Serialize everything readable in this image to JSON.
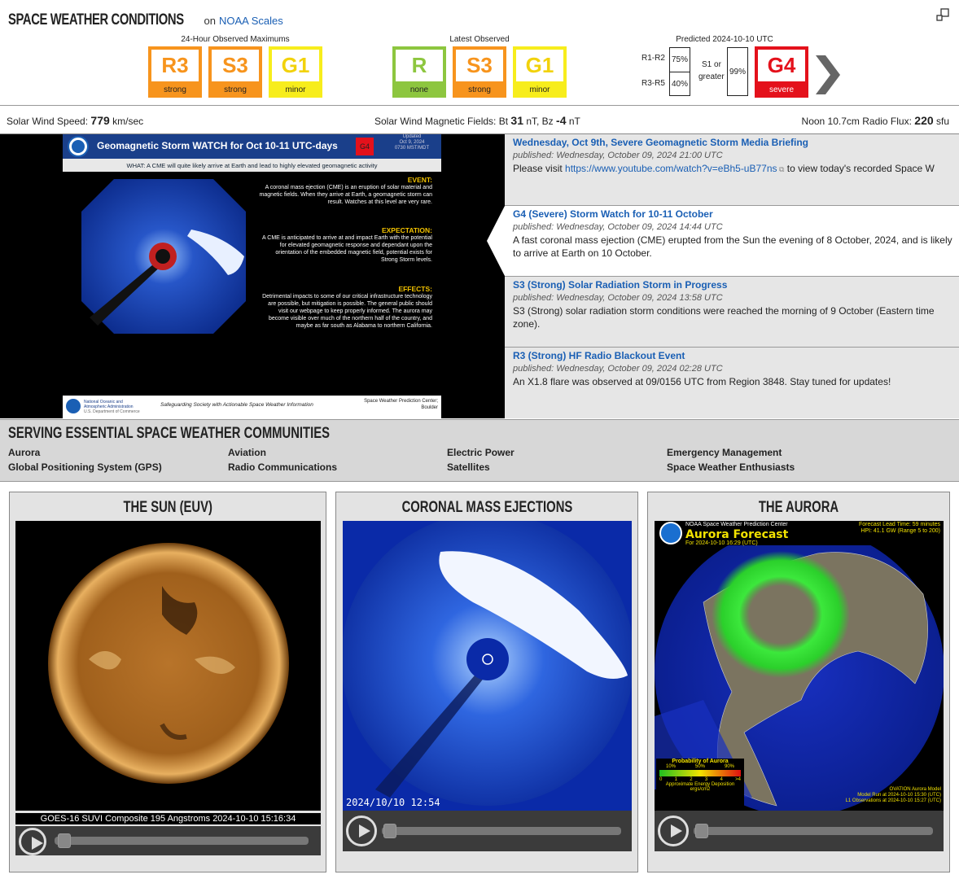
{
  "header": {
    "title": "SPACE WEATHER CONDITIONS",
    "on_text": "on",
    "scales_link": "NOAA Scales"
  },
  "observed": {
    "label": "24-Hour Observed Maximums",
    "scales": [
      {
        "code": "R3",
        "level": "strong",
        "color": "#f7941d"
      },
      {
        "code": "S3",
        "level": "strong",
        "color": "#f7941d"
      },
      {
        "code": "G1",
        "level": "minor",
        "color": "#f7ed1c"
      }
    ]
  },
  "latest": {
    "label": "Latest Observed",
    "scales": [
      {
        "code": "R",
        "level": "none",
        "color": "#8dc63f"
      },
      {
        "code": "S3",
        "level": "strong",
        "color": "#f7941d"
      },
      {
        "code": "G1",
        "level": "minor",
        "color": "#f7ed1c"
      }
    ]
  },
  "predicted": {
    "label": "Predicted 2024-10-10 UTC",
    "r1r2_label": "R1-R2",
    "r1r2_value": "75%",
    "r3r5_label": "R3-R5",
    "r3r5_value": "40%",
    "s1_label_1": "S1 or",
    "s1_label_2": "greater",
    "s1_value": "99%",
    "g": {
      "code": "G4",
      "level": "severe",
      "color": "#e4111b"
    }
  },
  "wind": {
    "speed_label": "Solar Wind Speed:",
    "speed_value": "779",
    "speed_unit": "km/sec",
    "mag_label": "Solar Wind Magnetic Fields: Bt",
    "bt_value": "31",
    "bt_unit": "nT, Bz",
    "bz_value": "-4",
    "bz_unit": "nT",
    "flux_label": "Noon 10.7cm Radio Flux:",
    "flux_value": "220",
    "flux_unit": "sfu"
  },
  "watch_graphic": {
    "title": "Geomagnetic Storm WATCH for Oct 10-11 UTC-days",
    "badge": "G4",
    "updated_1": "Updated",
    "updated_2": "Oct 9, 2024",
    "updated_3": "0730 MST/MDT",
    "what": "WHAT: A CME will quite likely arrive at Earth and lead to highly elevated geomagnetic activity",
    "event_h": "EVENT:",
    "event_t": "A coronal mass ejection (CME) is an eruption of solar material and magnetic fields. When they arrive at Earth, a geomagnetic storm can result. Watches at this level are very rare.",
    "expect_h": "EXPECTATION:",
    "expect_t": "A CME is anticipated to arrive at and impact Earth with the potential for elevated geomagnetic response and dependant upon the orientation of the embedded magnetic field, potential exists for Strong Storm levels.",
    "effects_h": "EFFECTS:",
    "effects_t": "Detrimental impacts to some of our critical infrastructure technology are possible, but mitigation is possible. The general public should visit our webpage to keep properly informed. The aurora may become visible over much of the northern half of the country, and maybe as far south as Alabama to northern California.",
    "footer_org": "National Oceanic and Atmospheric Administration",
    "footer_dept": "U.S. Department of Commerce",
    "footer_mid": "Safeguarding Society with Actionable Space Weather Information",
    "footer_right_1": "Space Weather Prediction Center;",
    "footer_right_2": "Boulder"
  },
  "news": [
    {
      "title": "Wednesday, Oct 9th, Severe Geomagnetic Storm Media Briefing",
      "date": "published: Wednesday, October 09, 2024 21:00 UTC",
      "body_pre": "Please visit ",
      "link": "https://www.youtube.com/watch?v=eBh5-uB77ns",
      "body_post": " to view today's recorded Space W"
    },
    {
      "title": "G4 (Severe) Storm Watch for 10-11 October",
      "date": "published: Wednesday, October 09, 2024 14:44 UTC",
      "body": "A fast coronal mass ejection (CME) erupted from the Sun the evening of 8 October, 2024, and is likely to arrive at Earth on 10 October."
    },
    {
      "title": "S3 (Strong) Solar Radiation Storm in Progress",
      "date": "published: Wednesday, October 09, 2024 13:58 UTC",
      "body": "S3 (Strong) solar radiation storm conditions were reached the morning of 9 October (Eastern time zone)."
    },
    {
      "title": "R3 (Strong) HF Radio Blackout Event",
      "date": "published: Wednesday, October 09, 2024 02:28 UTC",
      "body": "An X1.8 flare was observed at 09/0156 UTC from Region 3848. Stay tuned for updates!"
    }
  ],
  "serving": {
    "title": "SERVING ESSENTIAL SPACE WEATHER COMMUNITIES",
    "items": [
      "Aurora",
      "Global Positioning System (GPS)",
      "Aviation",
      "Radio Communications",
      "Electric Power",
      "Satellites",
      "Emergency Management",
      "Space Weather Enthusiasts"
    ]
  },
  "cards": [
    {
      "title": "THE SUN (EUV)",
      "caption": "GOES-16 SUVI Composite 195 Angstroms 2024-10-10 15:16:34"
    },
    {
      "title": "CORONAL MASS EJECTIONS",
      "caption": "2024/10/10 12:54"
    },
    {
      "title": "THE AURORA"
    }
  ],
  "aurora": {
    "org": "NOAA Space Weather Prediction Center",
    "title": "Aurora Forecast",
    "for": "For 2024-10-10 16:29 (UTC)",
    "lead": "Forecast Lead Time:  59 minutes",
    "hpi": "HPI:  41.1 GW (Range 5 to 200)",
    "prob_title": "Probability of Aurora",
    "prob_ticks": [
      "10%",
      "50%",
      "90%"
    ],
    "scale_ticks": [
      "0",
      "1",
      "2",
      "3",
      "4",
      ">4"
    ],
    "energy_1": "Approximate Energy Deposition",
    "energy_2": "ergs/cm2",
    "model_1": "OVATION Aurora Model",
    "model_2": "Model Run at 2024-10-10 15:30 (UTC)",
    "model_3": "L1 Observations at 2024-10-10 15:27 (UTC)"
  }
}
